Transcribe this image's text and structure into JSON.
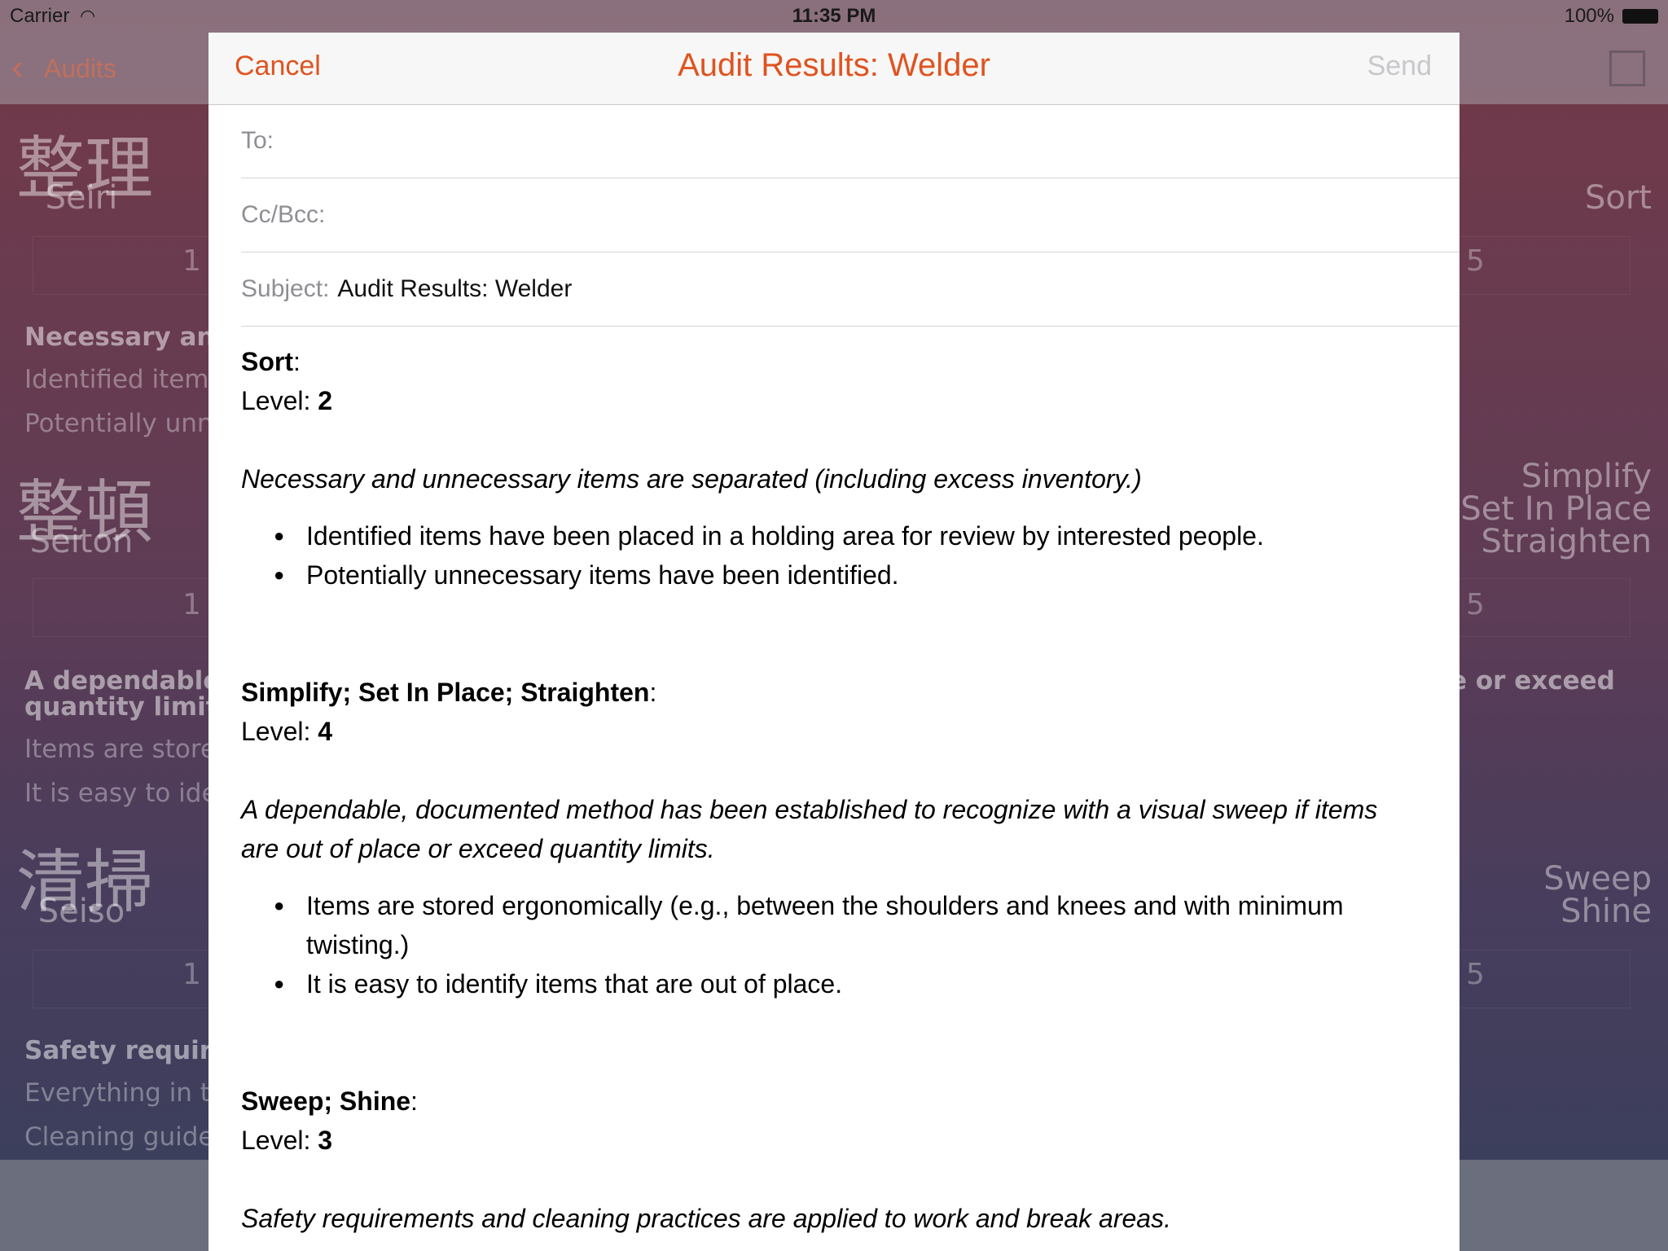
{
  "status_bar": {
    "carrier": "Carrier",
    "time": "11:35 PM",
    "battery": "100%"
  },
  "background": {
    "back_label": "Audits",
    "sections": [
      {
        "kanji": "整理",
        "romaji": "Seiri",
        "min": "1",
        "max": "5",
        "right_label": [
          "Sort"
        ],
        "bold": "Necessary and",
        "lines": [
          "Identified items",
          "Potentially unne"
        ]
      },
      {
        "kanji": "整頓",
        "romaji": "Seiton",
        "min": "1",
        "max": "5",
        "right_label": [
          "Simplify",
          "Set In Place",
          "Straighten"
        ],
        "bold": "A dependable,",
        "bold2": "quantity limits",
        "bold_right": "e or exceed",
        "lines": [
          "Items are store",
          "It is easy to iden"
        ]
      },
      {
        "kanji": "清掃",
        "romaji": "Seiso",
        "min": "1",
        "max": "5",
        "right_label": [
          "Sweep",
          "Shine"
        ],
        "bold": "Safety require",
        "lines": [
          "Everything in th",
          "Cleaning guidel"
        ]
      }
    ]
  },
  "compose": {
    "cancel": "Cancel",
    "title": "Audit Results: Welder",
    "send": "Send",
    "to_label": "To:",
    "cc_label": "Cc/Bcc:",
    "subject_label": "Subject:",
    "subject_value": "Audit Results: Welder",
    "level_label": "Level: ",
    "sections": [
      {
        "title": "Sort",
        "level": "2",
        "desc": "Necessary and unnecessary items are separated (including excess inventory.)",
        "items": [
          "Identified items have been placed in a holding area for review by interested people.",
          "Potentially unnecessary items have been identified."
        ]
      },
      {
        "title": "Simplify; Set In Place; Straighten",
        "level": "4",
        "desc": "A dependable, documented method has been established to recognize with a visual sweep if items are out of place or exceed quantity limits.",
        "items": [
          "Items are stored ergonomically (e.g., between the shoulders and knees and with minimum twisting.)",
          "It is easy to identify items that are out of place."
        ]
      },
      {
        "title": "Sweep; Shine",
        "level": "3",
        "desc": "Safety requirements and cleaning practices are applied to work and break areas.",
        "items": []
      }
    ]
  }
}
